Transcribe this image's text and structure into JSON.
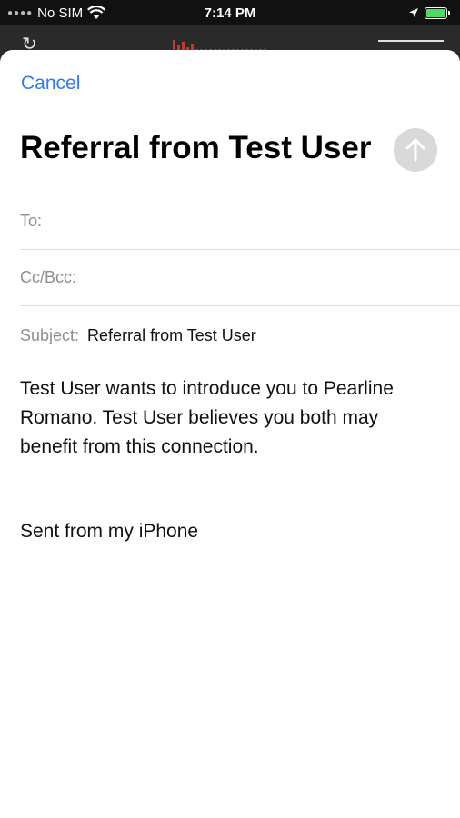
{
  "status_bar": {
    "carrier": "No SIM",
    "time": "7:14 PM"
  },
  "colors": {
    "accent": "#2f7bf6",
    "send_disabled": "#d9d9d9",
    "battery": "#4cd964"
  },
  "icons": [
    "signal-dots-icon",
    "wifi-icon",
    "location-arrow-icon",
    "battery-icon",
    "share-icon",
    "send-arrow-icon"
  ],
  "mail": {
    "cancel_label": "Cancel",
    "title": "Referral from Test User",
    "to_label": "To:",
    "cc_label": "Cc/Bcc:",
    "subject_label": "Subject:",
    "subject_value": "Referral from Test User",
    "body": "Test User wants to introduce you to Pearline Romano. Test User believes you both may benefit from this connection.",
    "signature": "Sent from my iPhone"
  }
}
